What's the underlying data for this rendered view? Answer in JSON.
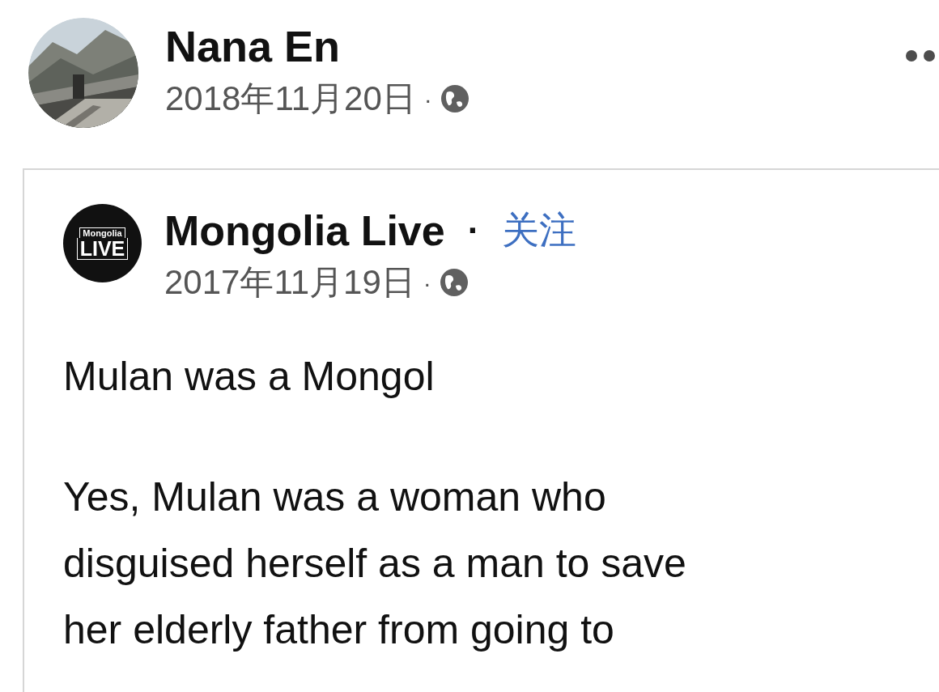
{
  "post": {
    "author": "Nana En",
    "date": "2018年11月20日",
    "separator": "·",
    "shared": {
      "logo": {
        "top": "Mongolia",
        "bottom": "LIVE"
      },
      "page": "Mongolia Live",
      "dot": "·",
      "follow": "关注",
      "date": "2017年11月19日",
      "separator": "·",
      "title": "Mulan was a Mongol",
      "paragraph": [
        "Yes, Mulan was a woman who",
        "disguised herself as a man to save",
        "her elderly father from going to"
      ]
    }
  }
}
